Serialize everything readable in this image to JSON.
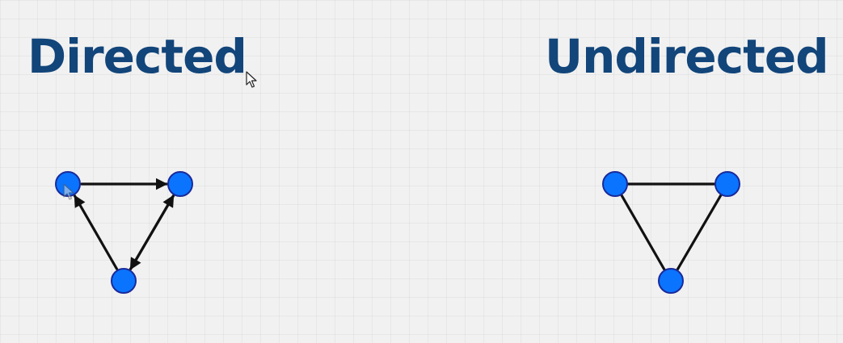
{
  "titles": {
    "directed": "Directed",
    "undirected": "Undirected"
  },
  "colors": {
    "title": "#12457a",
    "node_fill": "#0a74ff",
    "node_stroke": "#1a2a9a",
    "edge": "#111111",
    "background": "#f1f1f1"
  },
  "graphs": [
    {
      "name": "directed",
      "directed": true,
      "nodes": [
        "a",
        "b",
        "c"
      ],
      "edges": [
        {
          "from": "a",
          "to": "b"
        },
        {
          "from": "c",
          "to": "a"
        },
        {
          "from": "c",
          "to": "b"
        },
        {
          "from": "b",
          "to": "c"
        }
      ]
    },
    {
      "name": "undirected",
      "directed": false,
      "nodes": [
        "a",
        "b",
        "c"
      ],
      "edges": [
        {
          "from": "a",
          "to": "b"
        },
        {
          "from": "a",
          "to": "c"
        },
        {
          "from": "b",
          "to": "c"
        }
      ]
    }
  ],
  "icons": {
    "cursor": "mouse-pointer-icon"
  }
}
